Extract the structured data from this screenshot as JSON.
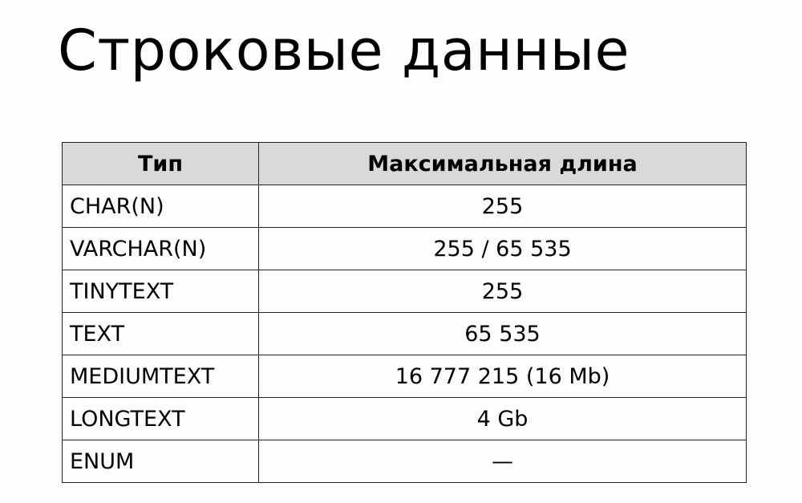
{
  "title": "Строковые данные",
  "table": {
    "headers": [
      "Тип",
      "Максимальная длина"
    ],
    "rows": [
      [
        "CHAR(N)",
        "255"
      ],
      [
        "VARCHAR(N)",
        "255 / 65 535"
      ],
      [
        "TINYTEXT",
        "255"
      ],
      [
        "TEXT",
        "65 535"
      ],
      [
        "MEDIUMTEXT",
        "16 777 215 (16 Mb)"
      ],
      [
        "LONGTEXT",
        "4 Gb"
      ],
      [
        "ENUM",
        "—"
      ]
    ]
  },
  "colors": {
    "background": "#fdfdfd",
    "header_bg": "#d9d9d9",
    "border": "#222222",
    "text": "#000000"
  }
}
